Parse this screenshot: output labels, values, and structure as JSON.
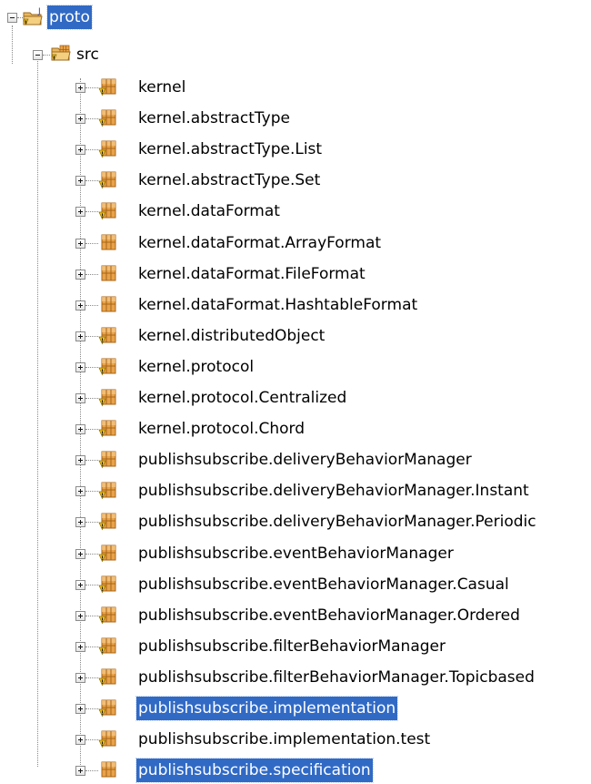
{
  "root": {
    "label": "proto",
    "icon": "java-project-icon",
    "expanded": true,
    "selected": true
  },
  "src": {
    "label": "src",
    "icon": "source-folder-icon",
    "expanded": true
  },
  "packages": [
    {
      "label": "kernel",
      "icon": "package-icon",
      "warning": true,
      "selected": false
    },
    {
      "label": "kernel.abstractType",
      "icon": "package-icon",
      "warning": true,
      "selected": false
    },
    {
      "label": "kernel.abstractType.List",
      "icon": "package-icon",
      "warning": true,
      "selected": false
    },
    {
      "label": "kernel.abstractType.Set",
      "icon": "package-icon",
      "warning": true,
      "selected": false
    },
    {
      "label": "kernel.dataFormat",
      "icon": "package-icon",
      "warning": true,
      "selected": false
    },
    {
      "label": "kernel.dataFormat.ArrayFormat",
      "icon": "package-icon",
      "warning": false,
      "selected": false
    },
    {
      "label": "kernel.dataFormat.FileFormat",
      "icon": "package-icon",
      "warning": false,
      "selected": false
    },
    {
      "label": "kernel.dataFormat.HashtableFormat",
      "icon": "package-icon",
      "warning": false,
      "selected": false
    },
    {
      "label": "kernel.distributedObject",
      "icon": "package-icon",
      "warning": true,
      "selected": false
    },
    {
      "label": "kernel.protocol",
      "icon": "package-icon",
      "warning": true,
      "selected": false
    },
    {
      "label": "kernel.protocol.Centralized",
      "icon": "package-icon",
      "warning": true,
      "selected": false
    },
    {
      "label": "kernel.protocol.Chord",
      "icon": "package-icon",
      "warning": true,
      "selected": false
    },
    {
      "label": "publishsubscribe.deliveryBehaviorManager",
      "icon": "package-icon",
      "warning": true,
      "selected": false
    },
    {
      "label": "publishsubscribe.deliveryBehaviorManager.Instant",
      "icon": "package-icon",
      "warning": true,
      "selected": false
    },
    {
      "label": "publishsubscribe.deliveryBehaviorManager.Periodic",
      "icon": "package-icon",
      "warning": true,
      "selected": false
    },
    {
      "label": "publishsubscribe.eventBehaviorManager",
      "icon": "package-icon",
      "warning": true,
      "selected": false
    },
    {
      "label": "publishsubscribe.eventBehaviorManager.Casual",
      "icon": "package-icon",
      "warning": true,
      "selected": false
    },
    {
      "label": "publishsubscribe.eventBehaviorManager.Ordered",
      "icon": "package-icon",
      "warning": true,
      "selected": false
    },
    {
      "label": "publishsubscribe.filterBehaviorManager",
      "icon": "package-icon",
      "warning": true,
      "selected": false
    },
    {
      "label": "publishsubscribe.filterBehaviorManager.Topicbased",
      "icon": "package-icon",
      "warning": true,
      "selected": false
    },
    {
      "label": "publishsubscribe.implementation",
      "icon": "package-icon",
      "warning": true,
      "selected": true
    },
    {
      "label": "publishsubscribe.implementation.test",
      "icon": "package-icon",
      "warning": true,
      "selected": false
    },
    {
      "label": "publishsubscribe.specification",
      "icon": "package-icon",
      "warning": false,
      "selected": true
    }
  ],
  "colors": {
    "selection": "#316ac5",
    "package_fill": "#e8a34a",
    "package_dark": "#a86418",
    "warning": "#f2c21a"
  }
}
